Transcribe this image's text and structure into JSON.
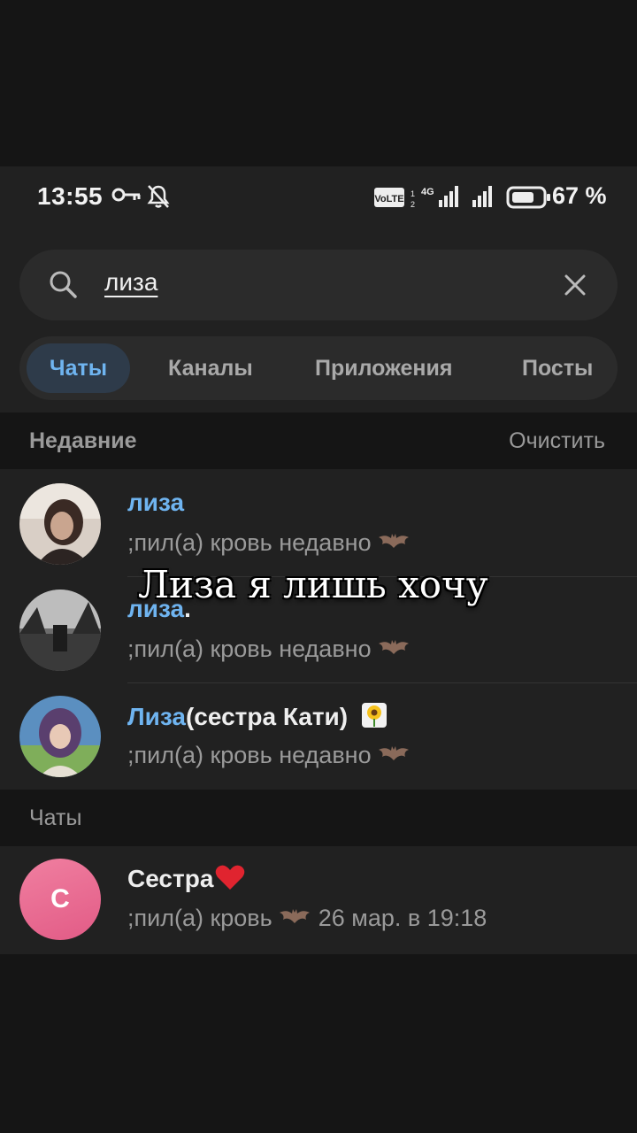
{
  "status_bar": {
    "time": "13:55",
    "volte_label": "VoLTE",
    "network_label": "4G",
    "battery_percent": "67 %"
  },
  "search": {
    "query": "лиза"
  },
  "tabs": [
    {
      "label": "Чаты",
      "active": true
    },
    {
      "label": "Каналы",
      "active": false
    },
    {
      "label": "Приложения",
      "active": false
    },
    {
      "label": "Посты",
      "active": false
    }
  ],
  "recent": {
    "header": "Недавние",
    "clear_label": "Очистить",
    "items": [
      {
        "name_highlight": "лиза",
        "name_rest": "",
        "status": ";пил(а) кровь недавно"
      },
      {
        "name_highlight": "лиза",
        "name_rest": ".",
        "status": ";пил(а) кровь недавно"
      },
      {
        "name_highlight": "Лиза",
        "name_rest": "(сестра Кати)",
        "status": ";пил(а) кровь недавно"
      }
    ]
  },
  "chats": {
    "header": "Чаты",
    "items": [
      {
        "avatar_letter": "С",
        "name": "Сестра",
        "status": ";пил(а) кровь",
        "date": "26 мар. в 19:18"
      }
    ]
  },
  "overlay_caption": "Лиза я лишь хочу",
  "colors": {
    "accent": "#6fb4f0",
    "background": "#212121",
    "avatar_pink": "#e25b86"
  }
}
